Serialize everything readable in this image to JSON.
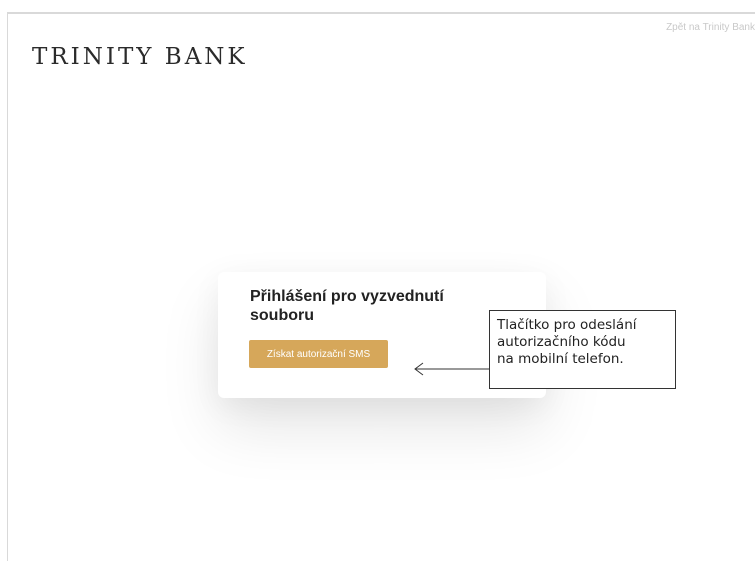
{
  "header": {
    "back_link": "Zpět na Trinity Bank",
    "logo": "TRINITY BANK"
  },
  "login_card": {
    "title": "Přihlášení pro vyzvednutí souboru",
    "sms_button_label": "Získat autorizační SMS",
    "button_color": "#d6a75a"
  },
  "annotation": {
    "lines": [
      "Tlačítko pro odeslání",
      "autorizačního kódu",
      "na mobilní telefon."
    ]
  }
}
